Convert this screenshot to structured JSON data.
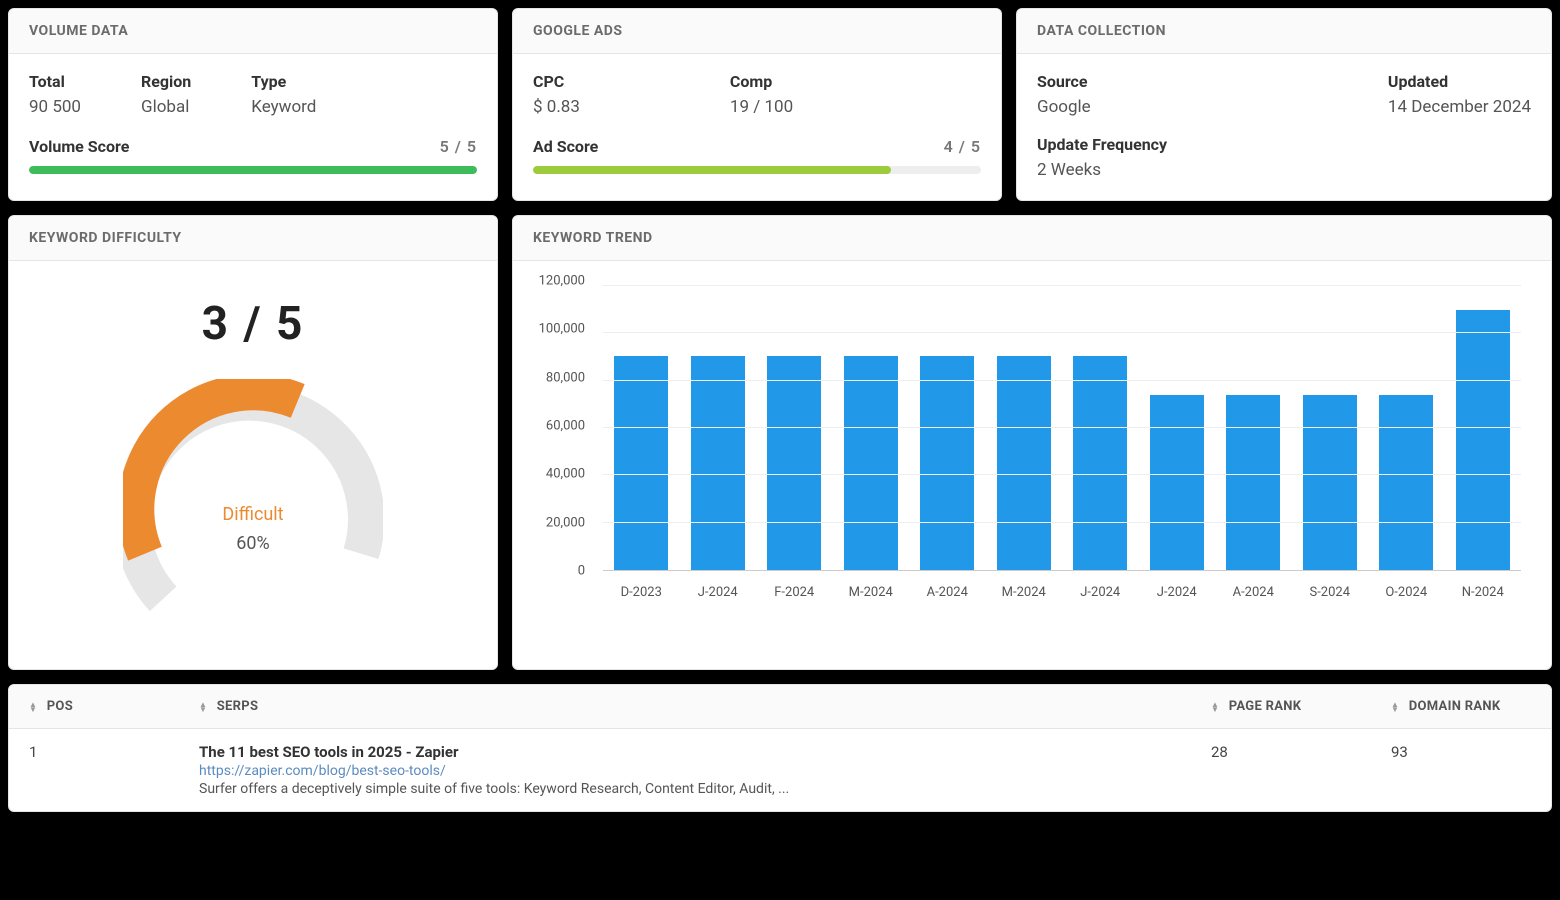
{
  "volume": {
    "header": "VOLUME DATA",
    "total_label": "Total",
    "total_value": "90 500",
    "region_label": "Region",
    "region_value": "Global",
    "type_label": "Type",
    "type_value": "Keyword",
    "score_label": "Volume Score",
    "score_value": "5 / 5",
    "score_pct": 100,
    "score_color": "green"
  },
  "ads": {
    "header": "GOOGLE ADS",
    "cpc_label": "CPC",
    "cpc_value": "$ 0.83",
    "comp_label": "Comp",
    "comp_value": "19 / 100",
    "score_label": "Ad Score",
    "score_value": "4 / 5",
    "score_pct": 80,
    "score_color": "lime"
  },
  "collection": {
    "header": "DATA COLLECTION",
    "source_label": "Source",
    "source_value": "Google",
    "updated_label": "Updated",
    "updated_value": "14 December 2024",
    "freq_label": "Update Frequency",
    "freq_value": "2 Weeks"
  },
  "difficulty": {
    "header": "KEYWORD DIFFICULTY",
    "score": "3 / 5",
    "label": "Difficult",
    "pct_text": "60%",
    "pct": 60
  },
  "trend": {
    "header": "KEYWORD TREND"
  },
  "chart_data": {
    "type": "bar",
    "title": "Keyword Trend",
    "xlabel": "",
    "ylabel": "",
    "ylim": [
      0,
      120000
    ],
    "y_ticks": [
      0,
      20000,
      40000,
      60000,
      80000,
      100000,
      120000
    ],
    "y_tick_labels": [
      "0",
      "20,000",
      "40,000",
      "60,000",
      "80,000",
      "100,000",
      "120,000"
    ],
    "categories": [
      "D-2023",
      "J-2024",
      "F-2024",
      "M-2024",
      "A-2024",
      "M-2024",
      "J-2024",
      "J-2024",
      "A-2024",
      "S-2024",
      "O-2024",
      "N-2024"
    ],
    "values": [
      90500,
      90500,
      90500,
      90500,
      90500,
      90500,
      90500,
      74000,
      74000,
      74000,
      74000,
      110000
    ]
  },
  "table": {
    "headers": {
      "pos": "POS",
      "serps": "SERPS",
      "page_rank": "PAGE RANK",
      "domain_rank": "DOMAIN RANK"
    },
    "rows": [
      {
        "pos": "1",
        "title": "The 11 best SEO tools in 2025 - Zapier",
        "url": "https://zapier.com/blog/best-seo-tools/",
        "desc": "Surfer offers a deceptively simple suite of five tools: Keyword Research, Content Editor, Audit, ...",
        "page_rank": "28",
        "domain_rank": "93"
      }
    ]
  }
}
